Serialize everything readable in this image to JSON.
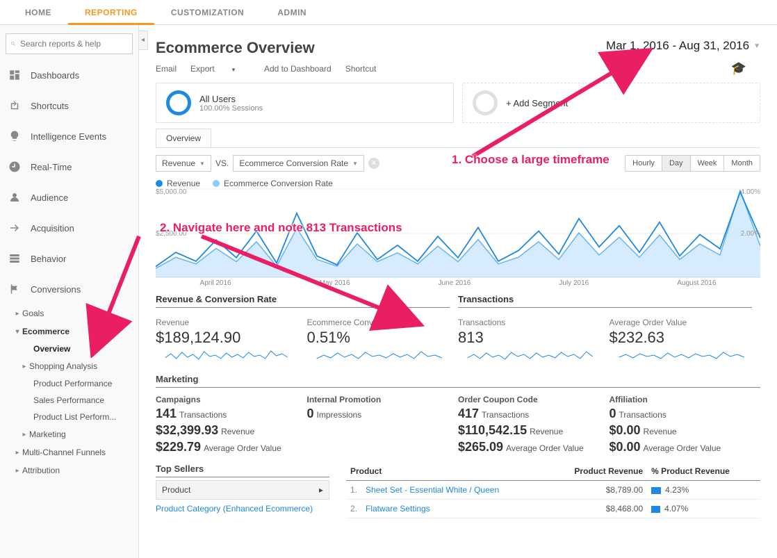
{
  "topnav": {
    "home": "HOME",
    "reporting": "REPORTING",
    "customization": "CUSTOMIZATION",
    "admin": "ADMIN"
  },
  "search": {
    "placeholder": "Search reports & help"
  },
  "sidebar": {
    "dashboards": "Dashboards",
    "shortcuts": "Shortcuts",
    "intel": "Intelligence Events",
    "realtime": "Real-Time",
    "audience": "Audience",
    "acquisition": "Acquisition",
    "behavior": "Behavior",
    "conversions": "Conversions",
    "goals": "Goals",
    "ecommerce": "Ecommerce",
    "overview": "Overview",
    "shopping": "Shopping Analysis",
    "prodperf": "Product Performance",
    "salesperf": "Sales Performance",
    "prodlist": "Product List Perform...",
    "marketing": "Marketing",
    "multichannel": "Multi-Channel Funnels",
    "attribution": "Attribution"
  },
  "page": {
    "title": "Ecommerce Overview"
  },
  "date_range": "Mar 1, 2016 - Aug 31, 2016",
  "toolbar": {
    "email": "Email",
    "export": "Export",
    "add": "Add to Dashboard",
    "shortcut": "Shortcut"
  },
  "segment": {
    "all": "All Users",
    "sub": "100.00% Sessions",
    "add": "+ Add Segment"
  },
  "tab_overview": "Overview",
  "metric1": "Revenue",
  "vs": "VS.",
  "metric2": "Ecommerce Conversion Rate",
  "gran": {
    "hourly": "Hourly",
    "day": "Day",
    "week": "Week",
    "month": "Month"
  },
  "legend": {
    "rev": "Revenue",
    "ecr": "Ecommerce Conversion Rate"
  },
  "ylabels": {
    "top": "$5,000.00",
    "mid": "$2,500.00",
    "rtop": "4.00%",
    "rmid": "2.00%"
  },
  "xaxis": {
    "apr": "April 2016",
    "may": "May 2016",
    "jun": "June 2016",
    "jul": "July 2016",
    "aug": "August 2016"
  },
  "section": {
    "revconv": "Revenue & Conversion Rate",
    "trans": "Transactions"
  },
  "kpi": {
    "rev_lbl": "Revenue",
    "rev_val": "$189,124.90",
    "ecr_lbl": "Ecommerce Conversion Rate",
    "ecr_val": "0.51%",
    "tx_lbl": "Transactions",
    "tx_val": "813",
    "aov_lbl": "Average Order Value",
    "aov_val": "$232.63"
  },
  "marketing_title": "Marketing",
  "mkt": {
    "camp_h": "Campaigns",
    "camp_tx": "141",
    "camp_tx_u": "Transactions",
    "camp_rev": "$32,399.93",
    "camp_rev_u": "Revenue",
    "camp_aov": "$229.79",
    "camp_aov_u": "Average Order Value",
    "ip_h": "Internal Promotion",
    "ip_imp": "0",
    "ip_imp_u": "Impressions",
    "occ_h": "Order Coupon Code",
    "occ_tx": "417",
    "occ_tx_u": "Transactions",
    "occ_rev": "$110,542.15",
    "occ_rev_u": "Revenue",
    "occ_aov": "$265.09",
    "occ_aov_u": "Average Order Value",
    "aff_h": "Affiliation",
    "aff_tx": "0",
    "aff_tx_u": "Transactions",
    "aff_rev": "$0.00",
    "aff_rev_u": "Revenue",
    "aff_aov": "$0.00",
    "aff_aov_u": "Average Order Value"
  },
  "sellers": {
    "title": "Top Sellers",
    "product": "Product",
    "pcat": "Product Category (Enhanced Ecommerce)",
    "th_product": "Product",
    "th_rev": "Product Revenue",
    "th_pct": "% Product Revenue",
    "r1_idx": "1.",
    "r1_name": "Sheet Set - Essential White / Queen",
    "r1_rev": "$8,789.00",
    "r1_pct": "4.23%",
    "r2_idx": "2.",
    "r2_name": "Flatware Settings",
    "r2_rev": "$8,468.00",
    "r2_pct": "4.07%"
  },
  "anno": {
    "a1": "1. Choose a large timeframe",
    "a2": "2. Navigate here and note 813 Transactions"
  },
  "chart_data": {
    "type": "line",
    "x_range": [
      "2016-03-01",
      "2016-08-31"
    ],
    "y1_label": "Revenue",
    "y1_range": [
      0,
      5000
    ],
    "y2_label": "Ecommerce Conversion Rate (%)",
    "y2_range": [
      0,
      4
    ],
    "series": [
      {
        "name": "Revenue",
        "axis": "y1",
        "values": [
          600,
          1400,
          900,
          2100,
          1100,
          2600,
          800,
          3600,
          1200,
          700,
          2500,
          1000,
          1800,
          900,
          2300,
          1100,
          2800,
          900,
          1500,
          2600,
          1300,
          3300,
          1700,
          2900,
          1400,
          3100,
          1200,
          2400,
          1600,
          4800,
          2200
        ]
      },
      {
        "name": "Ecommerce Conversion Rate",
        "axis": "y2",
        "values": [
          0.4,
          0.9,
          0.6,
          1.3,
          0.7,
          1.6,
          0.5,
          2.2,
          0.8,
          0.5,
          1.5,
          0.7,
          1.1,
          0.6,
          1.4,
          0.7,
          1.7,
          0.6,
          0.9,
          1.6,
          0.8,
          2.0,
          1.0,
          1.8,
          0.9,
          1.9,
          0.8,
          1.5,
          1.0,
          3.9,
          1.4
        ]
      }
    ]
  }
}
